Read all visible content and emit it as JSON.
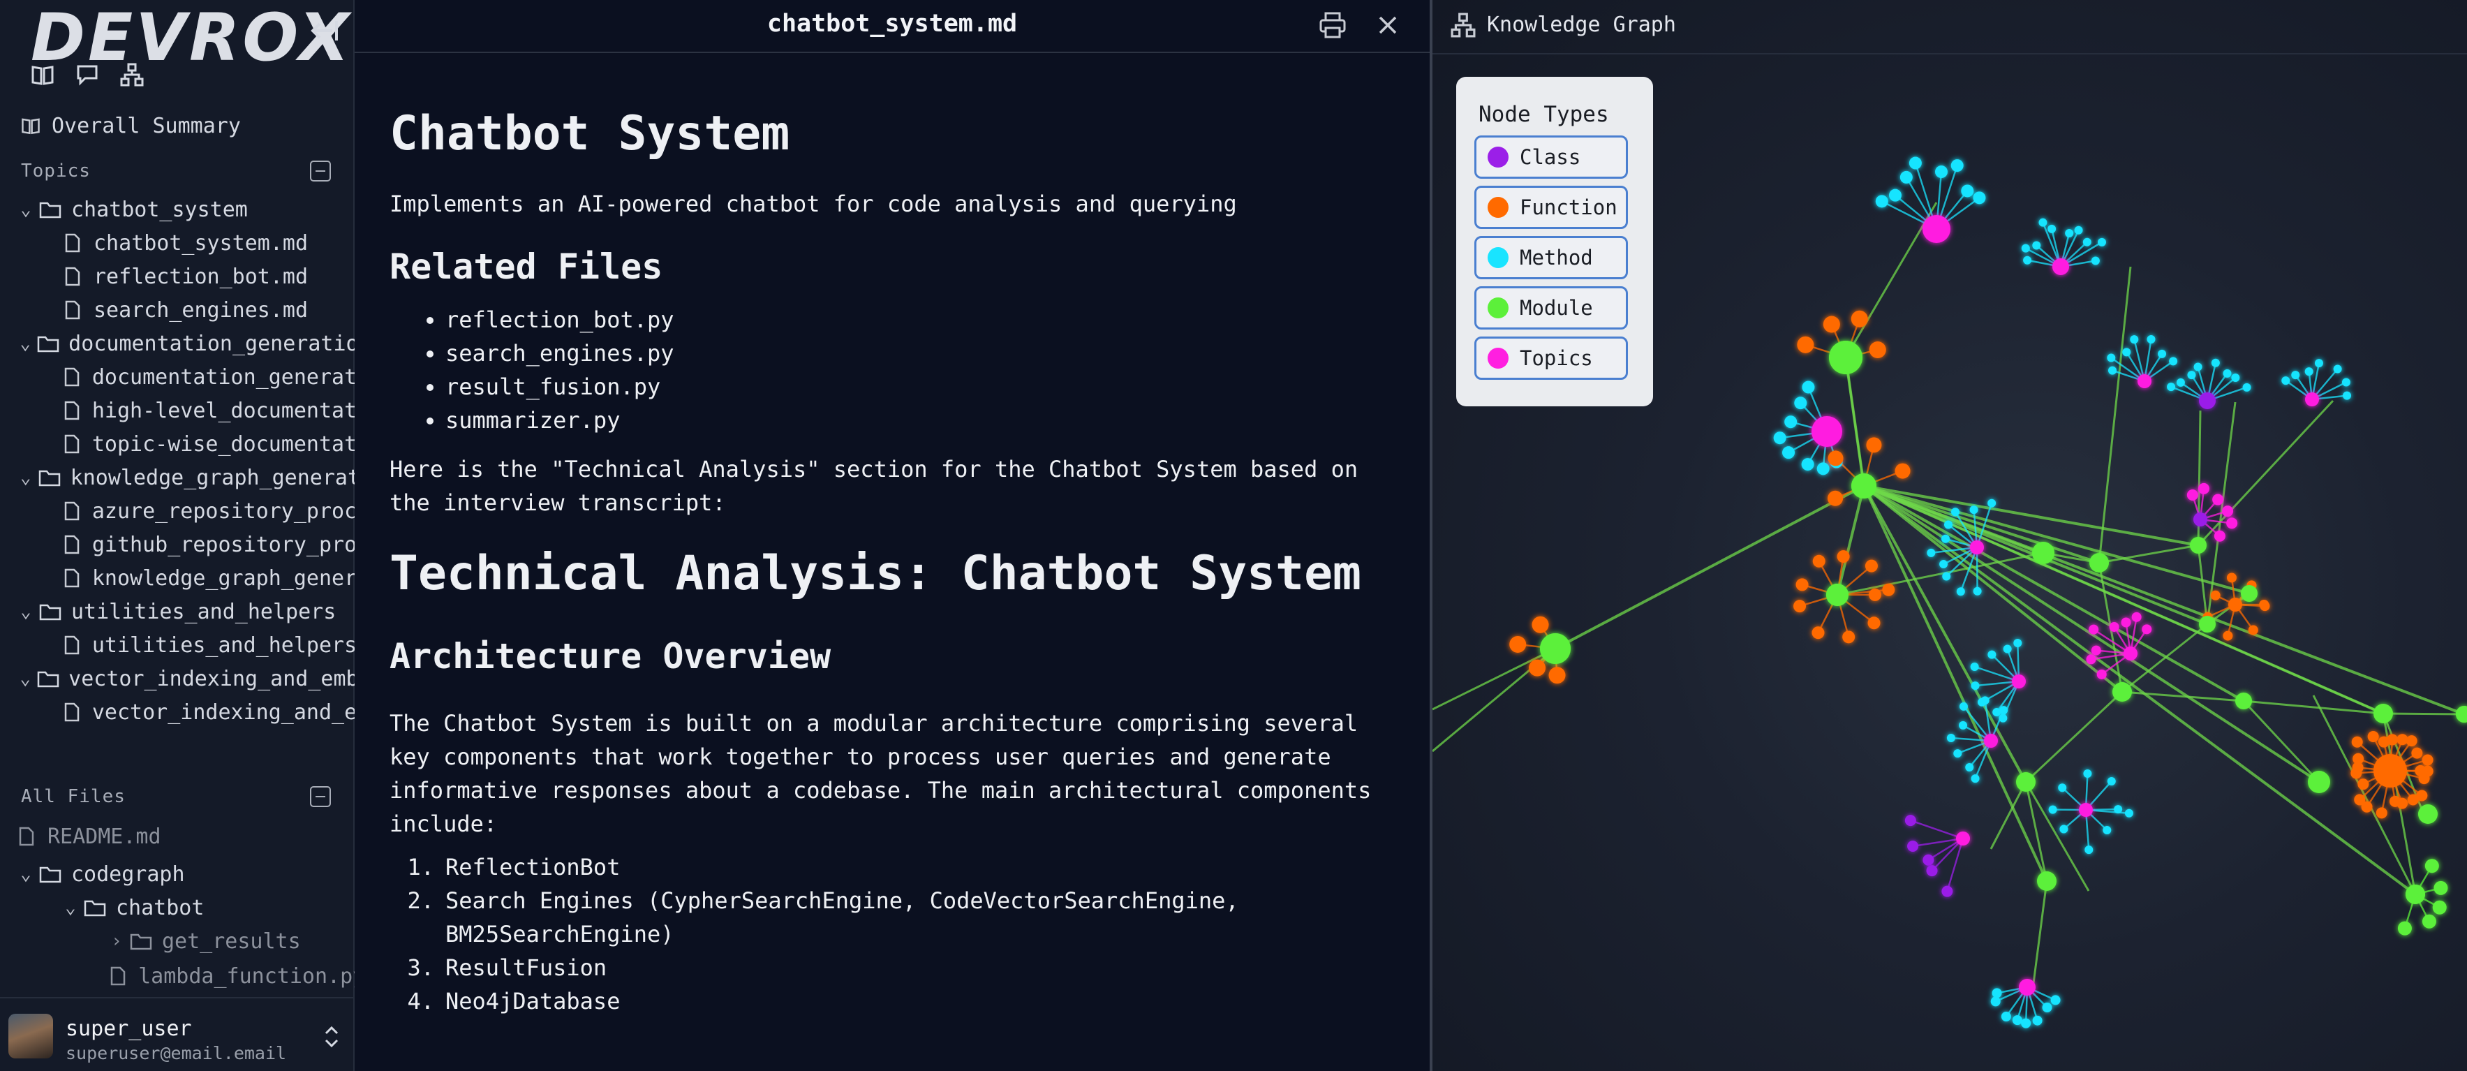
{
  "sidebar": {
    "logo": "DEVROX",
    "overall_summary": "Overall Summary",
    "topics_label": "Topics",
    "topics": [
      {
        "label": "chatbot_system",
        "children": [
          "chatbot_system.md",
          "reflection_bot.md",
          "search_engines.md"
        ]
      },
      {
        "label": "documentation_generation",
        "children": [
          "documentation_generati",
          "high-level_documentati",
          "topic-wise_documentati"
        ]
      },
      {
        "label": "knowledge_graph_generat",
        "children": [
          "azure_repository_proce",
          "github_repository_proc",
          "knowledge_graph_genera"
        ]
      },
      {
        "label": "utilities_and_helpers",
        "children": [
          "utilities_and_helpers."
        ]
      },
      {
        "label": "vector_indexing_and_embe",
        "children": [
          "vector_indexing_and_em"
        ]
      }
    ],
    "all_files_label": "All Files",
    "files": {
      "readme": "README.md",
      "codegraph": "codegraph",
      "chatbot": "chatbot",
      "get_results": "get_results",
      "lambda_function": "lambda_function.py"
    }
  },
  "user": {
    "name": "super_user",
    "email": "superuser@email.email"
  },
  "document": {
    "filename": "chatbot_system.md",
    "h1": "Chatbot System",
    "intro": "Implements an AI-powered chatbot for code analysis and querying",
    "related_heading": "Related Files",
    "related_files": [
      "reflection_bot.py",
      "search_engines.py",
      "result_fusion.py",
      "summarizer.py"
    ],
    "analysis_intro_1": "Here is the \"Technical Analysis\" section for the Chatbot System based on",
    "analysis_intro_2": "the interview transcript:",
    "analysis_heading": "Technical Analysis: Chatbot System",
    "arch_heading": "Architecture Overview",
    "arch_para_lines": [
      "The Chatbot System is built on a modular architecture comprising several",
      "key components that work together to process user queries and generate",
      "informative responses about a codebase. The main architectural components",
      "include:"
    ],
    "components": [
      {
        "num": "1.",
        "line1": "ReflectionBot",
        "line2": ""
      },
      {
        "num": "2.",
        "line1": "Search Engines (CypherSearchEngine, CodeVectorSearchEngine,",
        "line2": "BM25SearchEngine)"
      },
      {
        "num": "3.",
        "line1": "ResultFusion",
        "line2": ""
      },
      {
        "num": "4.",
        "line1": "Neo4jDatabase",
        "line2": ""
      }
    ]
  },
  "graph": {
    "title": "Knowledge Graph",
    "legend_title": "Node Types",
    "legend": [
      {
        "label": "Class",
        "color": "#9b1fe8"
      },
      {
        "label": "Function",
        "color": "#ff6a00"
      },
      {
        "label": "Method",
        "color": "#19e4ff"
      },
      {
        "label": "Module",
        "color": "#5cf03a"
      },
      {
        "label": "Topics",
        "color": "#ff1fe0"
      }
    ]
  }
}
